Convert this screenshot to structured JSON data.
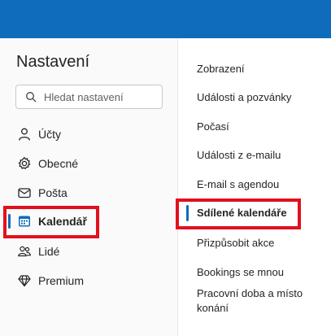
{
  "settings": {
    "title": "Nastavení",
    "search": {
      "placeholder": "Hledat nastavení",
      "value": ""
    },
    "nav": [
      {
        "label": "Účty",
        "icon": "person-icon",
        "active": false
      },
      {
        "label": "Obecné",
        "icon": "gear-icon",
        "active": false
      },
      {
        "label": "Pošta",
        "icon": "mail-icon",
        "active": false
      },
      {
        "label": "Kalendář",
        "icon": "calendar-icon",
        "active": true
      },
      {
        "label": "Lidé",
        "icon": "people-icon",
        "active": false
      },
      {
        "label": "Premium",
        "icon": "diamond-icon",
        "active": false
      }
    ],
    "calendar_sections": [
      {
        "label": "Zobrazení",
        "active": false
      },
      {
        "label": "Události a pozvánky",
        "active": false
      },
      {
        "label": "Počasí",
        "active": false
      },
      {
        "label": "Události z e-mailu",
        "active": false
      },
      {
        "label": "E-mail s agendou",
        "active": false
      },
      {
        "label": "Sdílené kalendáře",
        "active": true
      },
      {
        "label": "Přizpůsobit akce",
        "active": false
      },
      {
        "label": "Bookings se mnou",
        "active": false
      },
      {
        "label": "Pracovní doba a místo konání",
        "active": false
      }
    ]
  },
  "colors": {
    "accent": "#0f6cbd",
    "highlight_box": "#e3101d",
    "sidebar_bg": "#fafafa"
  }
}
